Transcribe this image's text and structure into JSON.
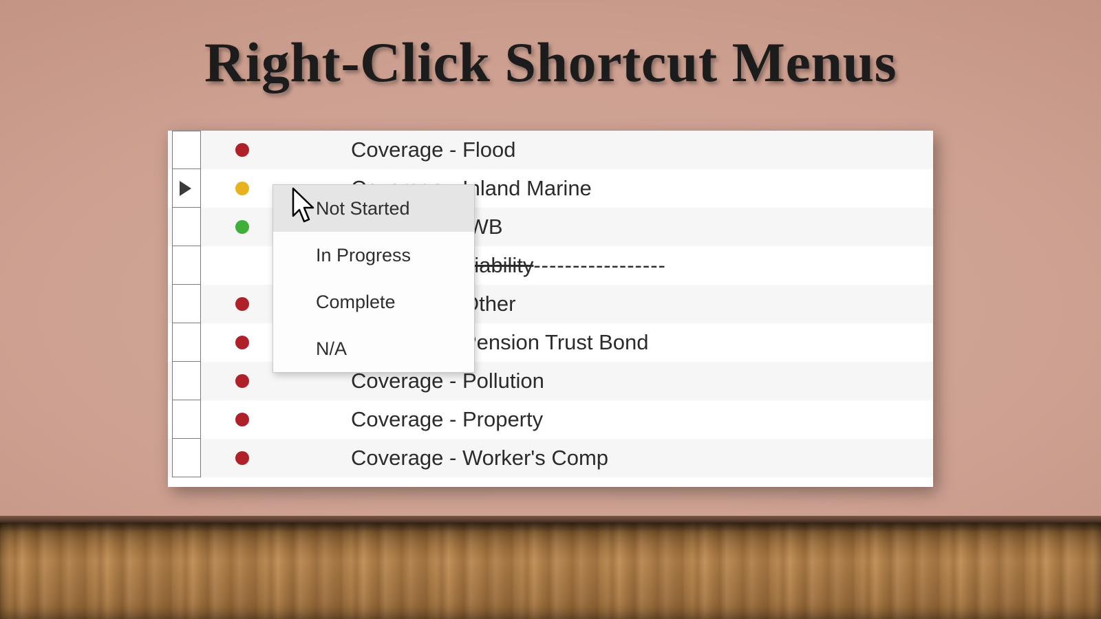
{
  "title": "Right-Click Shortcut Menus",
  "rows": [
    {
      "label": "Coverage - Flood",
      "dot": "red",
      "selected": false,
      "strike": false
    },
    {
      "label": "Coverage - Inland Marine",
      "dot": "yellow",
      "selected": true,
      "strike": false
    },
    {
      "label": "Coverage - IWB",
      "dot": "green",
      "selected": false,
      "strike": false
    },
    {
      "label": "Coverage - Liability",
      "dot": "",
      "selected": false,
      "strike": true
    },
    {
      "label": "Coverage - Other",
      "dot": "red",
      "selected": false,
      "strike": false
    },
    {
      "label": "Coverage - Pension Trust Bond",
      "dot": "red",
      "selected": false,
      "strike": false
    },
    {
      "label": "Coverage - Pollution",
      "dot": "red",
      "selected": false,
      "strike": false
    },
    {
      "label": "Coverage - Property",
      "dot": "red",
      "selected": false,
      "strike": false
    },
    {
      "label": "Coverage - Worker's Comp",
      "dot": "red",
      "selected": false,
      "strike": false
    }
  ],
  "row_labels_split": {
    "3": {
      "main": "Coverage - Liability",
      "trail": "-----------------"
    }
  },
  "context_menu": {
    "items": [
      {
        "label": "Not Started",
        "hover": true
      },
      {
        "label": "In Progress",
        "hover": false
      },
      {
        "label": "Complete",
        "hover": false
      },
      {
        "label": "N/A",
        "hover": false
      }
    ]
  }
}
